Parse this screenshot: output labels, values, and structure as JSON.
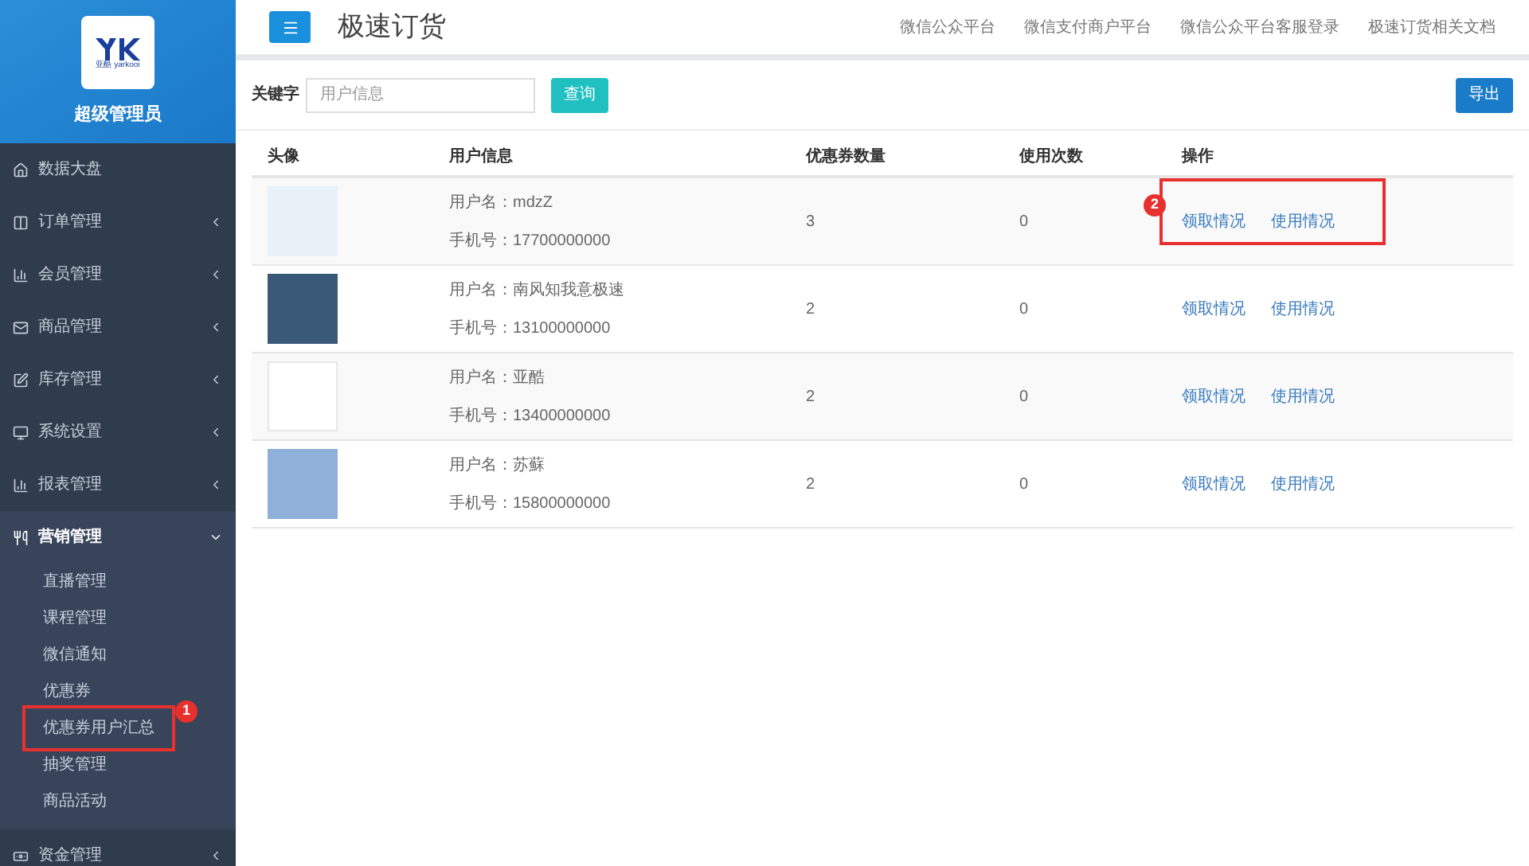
{
  "sidebar": {
    "logo_text": "亚酷 yarkooi",
    "role": "超级管理员",
    "items": [
      {
        "label": "数据大盘",
        "expanded": false,
        "has_arrow": false
      },
      {
        "label": "订单管理",
        "expanded": false,
        "has_arrow": true
      },
      {
        "label": "会员管理",
        "expanded": false,
        "has_arrow": true
      },
      {
        "label": "商品管理",
        "expanded": false,
        "has_arrow": true
      },
      {
        "label": "库存管理",
        "expanded": false,
        "has_arrow": true
      },
      {
        "label": "系统设置",
        "expanded": false,
        "has_arrow": true
      },
      {
        "label": "报表管理",
        "expanded": false,
        "has_arrow": true
      },
      {
        "label": "营销管理",
        "expanded": true,
        "has_arrow": true,
        "children": [
          {
            "label": "直播管理",
            "boxed": false
          },
          {
            "label": "课程管理",
            "boxed": false
          },
          {
            "label": "微信通知",
            "boxed": false
          },
          {
            "label": "优惠券",
            "boxed": false
          },
          {
            "label": "优惠券用户汇总",
            "boxed": true,
            "badge": "1"
          },
          {
            "label": "抽奖管理",
            "boxed": false
          },
          {
            "label": "商品活动",
            "boxed": false
          }
        ]
      },
      {
        "label": "资金管理",
        "expanded": false,
        "has_arrow": true
      }
    ]
  },
  "header": {
    "title": "极速订货",
    "links": [
      "微信公众平台",
      "微信支付商户平台",
      "微信公众平台客服登录",
      "极速订货相关文档"
    ]
  },
  "search": {
    "label": "关键字",
    "placeholder": "用户信息",
    "button": "查询",
    "export": "导出"
  },
  "table": {
    "columns": [
      "头像",
      "用户信息",
      "优惠券数量",
      "使用次数",
      "操作"
    ],
    "rows": [
      {
        "name": "用户名：mdzZ",
        "phone": "手机号：17700000000",
        "coupons": "3",
        "uses": "0",
        "actions": [
          "领取情况",
          "使用情况"
        ],
        "boxed": true,
        "badge": "2"
      },
      {
        "name": "用户名：南风知我意极速",
        "phone": "手机号：13100000000",
        "coupons": "2",
        "uses": "0",
        "actions": [
          "领取情况",
          "使用情况"
        ],
        "boxed": false
      },
      {
        "name": "用户名：亚酷",
        "phone": "手机号：13400000000",
        "coupons": "2",
        "uses": "0",
        "actions": [
          "领取情况",
          "使用情况"
        ],
        "boxed": false
      },
      {
        "name": "用户名：苏蘇",
        "phone": "手机号：15800000000",
        "coupons": "2",
        "uses": "0",
        "actions": [
          "领取情况",
          "使用情况"
        ],
        "boxed": false
      }
    ]
  }
}
